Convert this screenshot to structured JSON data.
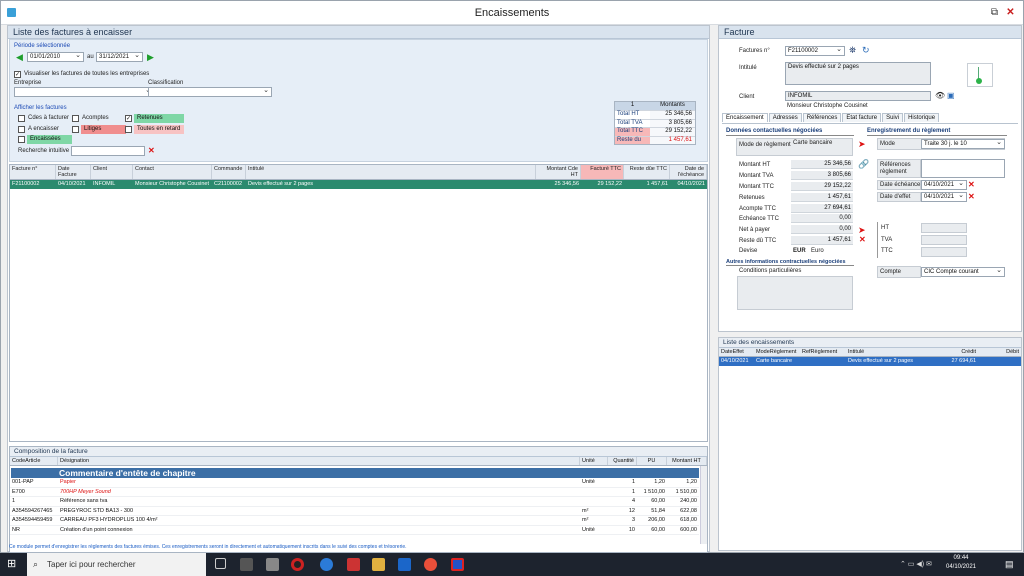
{
  "window": {
    "title": "Encaissements"
  },
  "left": {
    "title": "Liste des factures à encaisser",
    "period_label": "Période sélectionnée",
    "date_from": "01/01/2010",
    "au": "au",
    "date_to": "31/12/2021",
    "visualiser": "Visualiser les factures de toutes les entreprises",
    "entreprise": "Entreprise",
    "classification": "Classification",
    "afficher": "Afficher les factures",
    "chk_cdes": "Cdes à facturer",
    "chk_acomptes": "Acomptes",
    "chk_retenues": "Retenues",
    "chk_aenc": "A encaisser",
    "chk_litiges": "Litiges",
    "chk_retard": "Toutes en retard",
    "chk_encaissees": "Encaissées",
    "recherche": "Recherche intuitive",
    "totals": {
      "h1": "1",
      "h2": "Montants",
      "rows": [
        {
          "k": "Total HT",
          "v": "25 346,56"
        },
        {
          "k": "Total TVA",
          "v": "3 805,66"
        },
        {
          "k": "Total TTC",
          "v": "29 152,22"
        },
        {
          "k": "Reste du",
          "v": "1 457,61"
        }
      ]
    }
  },
  "grid": {
    "headers": [
      "Facture n°",
      "Date Facture",
      "Client",
      "Contact",
      "Commande",
      "Intitulé",
      "Montant Cde HT",
      "Facturé TTC",
      "Reste dûe TTC",
      "Date de l'échéance"
    ],
    "row": [
      "F21100002",
      "04/10/2021",
      "INFOMIL",
      "Monsieur Christophe Cousinet",
      "C21100002",
      "Devis effectué sur 2 pages",
      "25 346,56",
      "29 152,22",
      "1 457,61",
      "04/10/2021"
    ]
  },
  "comp": {
    "title": "Composition de la facture",
    "headers": [
      "CodeArticle",
      "Désignation",
      "Unité",
      "Quantité",
      "PU",
      "Montant HT"
    ],
    "chapter": "Commentaire d'entête de chapitre",
    "rows": [
      [
        "001-PAP",
        "Papier",
        "Unité",
        "1",
        "1,20",
        "1,20"
      ],
      [
        "E700",
        "700HP Meyer Sound",
        "",
        "1",
        "1 510,00",
        "1 510,00"
      ],
      [
        "1",
        "Référence sans tva",
        "",
        "4",
        "60,00",
        "240,00"
      ],
      [
        "A354594267465",
        "PREGYROC STD BA13 - 300",
        "m²",
        "12",
        "51,84",
        "622,08"
      ],
      [
        "A354594459459",
        "CARREAU PF3 HYDROPLUS 100  4/m²",
        "m²",
        "3",
        "206,00",
        "618,00"
      ],
      [
        "NR",
        "Création d'un point connexion",
        "Unité",
        "10",
        "60,00",
        "600,00"
      ]
    ],
    "info": "Ce module permet d'enregistrer les règlements des factures émises. Ces enregistrements seront in directement et automatiquement inscrits dans le suivi des comptes et trésorerie."
  },
  "facture": {
    "title": "Facture",
    "numero_label": "Factures n°",
    "numero": "F21100002",
    "intitule_label": "Intitulé",
    "intitule": "Devis effectué sur 2 pages",
    "client_label": "Client",
    "client": "INFOMIL",
    "contact": "Monsieur Christophe Cousinet",
    "tabs": [
      "Encaissement",
      "Adresses",
      "Références",
      "Etat facture",
      "Suivi",
      "Historique"
    ],
    "donnees": "Données contactuelles négociées",
    "mode_label": "Mode de règlement",
    "mode_val": "Carte bancaire",
    "fields": [
      {
        "k": "Montant HT",
        "v": "25 346,56"
      },
      {
        "k": "Montant TVA",
        "v": "3 805,66"
      },
      {
        "k": "Montant TTC",
        "v": "29 152,22"
      },
      {
        "k": "Retenues",
        "v": "1 457,61"
      },
      {
        "k": "Acompte TTC",
        "v": "27 694,61"
      },
      {
        "k": "Echéance TTC",
        "v": "0,00"
      },
      {
        "k": "Net à payer",
        "v": "0,00"
      },
      {
        "k": "Reste dû TTC",
        "v": "1 457,61"
      }
    ],
    "devise_label": "Devise",
    "devise": "EUR",
    "devise_name": "Euro",
    "autres": "Autres informations contractuelles négociées",
    "conditions": "Conditions particulières",
    "enreg": "Enregistrement du règlement",
    "mode2_label": "Mode",
    "mode2": "Traite 30 j. le 10",
    "refs_label": "Références règlement",
    "date_ech_label": "Date échéance",
    "date_ech": "04/10/2021",
    "date_eff_label": "Date d'effet",
    "date_eff": "04/10/2021",
    "ht": "HT",
    "tva": "TVA",
    "ttc": "TTC",
    "compte_label": "Compte",
    "compte": "CIC Compte courant"
  },
  "encaissements": {
    "title": "Liste des encaissements",
    "headers": [
      "DateEffet",
      "ModeRèglement",
      "RefRèglement",
      "Intitulé",
      "Crédit",
      "Débit"
    ],
    "row": [
      "04/10/2021",
      "Carte bancaire",
      "",
      "Devis effectué sur 2 pages",
      "27 694,61",
      ""
    ]
  },
  "taskbar": {
    "search": "Taper ici pour rechercher",
    "time": "09:44",
    "date": "04/10/2021"
  }
}
